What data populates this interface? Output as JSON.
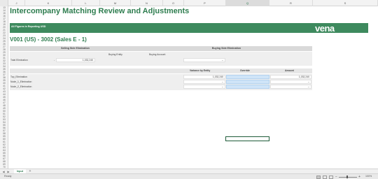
{
  "columns": [
    "J",
    "K",
    "L",
    "M",
    "N",
    "O",
    "P",
    "Q",
    "R",
    "S"
  ],
  "rows": [
    "13",
    "14",
    "15",
    "16",
    "17",
    "18",
    "19",
    "20",
    "21",
    "22",
    "23",
    "24",
    "25",
    "26",
    "27",
    "28",
    "29",
    "30",
    "31",
    "32",
    "33",
    "34",
    "35",
    "36",
    "37",
    "38",
    "39",
    "40",
    "41",
    "42",
    "43",
    "44",
    "45",
    "46",
    "47",
    "48",
    "49",
    "50",
    "51",
    "52",
    "53",
    "54",
    "55",
    "56",
    "57",
    "58",
    "59",
    "60",
    "61",
    "62",
    "63",
    "64",
    "65",
    "66",
    "67",
    "68",
    "69",
    "70",
    "71",
    "72",
    "73",
    "74",
    "75",
    "76",
    "77",
    "78",
    "79"
  ],
  "row_labels_visible": [
    "13",
    "14",
    "15",
    "16",
    "17",
    "18",
    "19",
    "20",
    "21",
    "22",
    "23",
    "24",
    "25",
    "26",
    "27",
    "28",
    "29",
    "30",
    "31",
    "32",
    "33",
    "34",
    "35",
    "36",
    "37",
    "38",
    "39",
    "40",
    "41",
    "42",
    "43",
    "44",
    "45",
    "46",
    "47",
    "48",
    "49",
    "50",
    "51",
    "52",
    "53",
    "54",
    "55",
    "56",
    "57",
    "58",
    "59",
    "60",
    "61",
    "62",
    "63",
    "64",
    "65",
    "66",
    "67",
    "68",
    "69",
    "70"
  ],
  "report": {
    "title": "Intercompany Matching Review and Adjustments",
    "banner_text": "All Figures in Reporting USD",
    "logo_text": "vena",
    "entity": "V001 (US) - 3002 (Sales E - 1)"
  },
  "selling": {
    "header": "Selling Side Elimination",
    "total_label": "Total Elimination",
    "total_prefix": "-",
    "total_value": "1,032,240"
  },
  "buying": {
    "header": "Buying Side Elimination",
    "entity_label": "Buying Entity",
    "account_label": "Buying Account",
    "dropdown_value": "--"
  },
  "adjust": {
    "variance_header": "Variance by Entity",
    "override_header": "Override",
    "amount_header": "Amount",
    "rows": [
      {
        "label": "Top_Elimination",
        "variance": "1,032,240",
        "override": "",
        "amount": "1,032,240"
      },
      {
        "label": "Node_1_Elimination",
        "variance": "--",
        "override": "",
        "amount": "--"
      },
      {
        "label": "Node_2_Elimination",
        "variance": "--",
        "override": "",
        "amount": "--"
      }
    ]
  },
  "sheet_tab": "Input",
  "status": {
    "ready": "Ready",
    "zoom": "100%"
  },
  "colors": {
    "accent_green": "#2e7d4f",
    "banner_green": "#3e8a5e",
    "override_blue": "#cfe4f8"
  }
}
